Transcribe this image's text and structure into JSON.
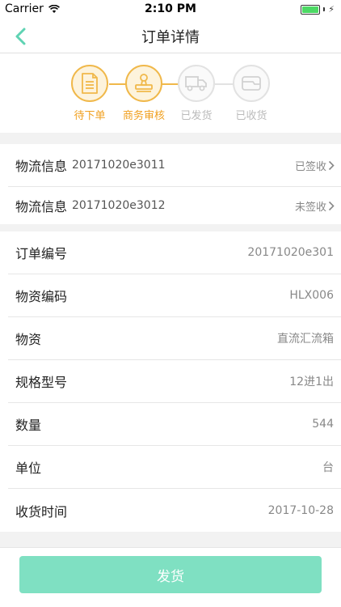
{
  "status_bar": {
    "carrier": "Carrier",
    "time": "2:10 PM"
  },
  "nav": {
    "title": "订单详情"
  },
  "steps": [
    {
      "label": "待下单",
      "state": "active",
      "icon": "document-icon"
    },
    {
      "label": "商务审核",
      "state": "active",
      "icon": "stamp-icon"
    },
    {
      "label": "已发货",
      "state": "inactive",
      "icon": "truck-icon"
    },
    {
      "label": "已收货",
      "state": "inactive",
      "icon": "wallet-icon"
    }
  ],
  "logistics": [
    {
      "label": "物流信息",
      "code": "20171020e3011",
      "status": "已签收"
    },
    {
      "label": "物流信息",
      "code": "20171020e3012",
      "status": "未签收"
    }
  ],
  "details": [
    {
      "label": "订单编号",
      "value": "20171020e301"
    },
    {
      "label": "物资编码",
      "value": "HLX006"
    },
    {
      "label": "物资",
      "value": "直流汇流箱"
    },
    {
      "label": "规格型号",
      "value": "12进1出"
    },
    {
      "label": "数量",
      "value": "544"
    },
    {
      "label": "单位",
      "value": "台"
    },
    {
      "label": "收货时间",
      "value": "2017-10-28"
    }
  ],
  "ship_button": {
    "label": "发货"
  },
  "colors": {
    "accent_orange": "#f0b84a",
    "accent_green": "#7fe0c2",
    "back_arrow": "#5fd3b3"
  }
}
